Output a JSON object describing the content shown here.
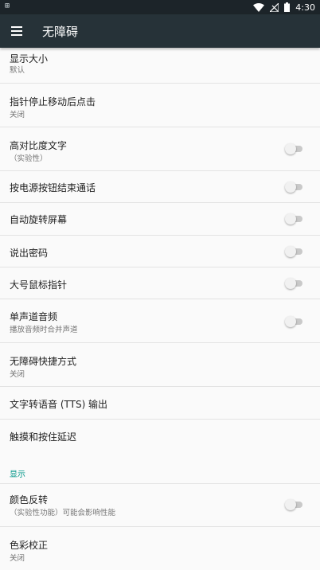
{
  "status_bar": {
    "left_icon": "sim-icon",
    "time": "4:30",
    "icons": [
      "wifi-icon",
      "signal-icon",
      "battery-icon"
    ]
  },
  "app_bar": {
    "menu_icon": "menu-icon",
    "title": "无障碍"
  },
  "list": {
    "display_size": {
      "title": "显示大小",
      "summary": "默认"
    },
    "dwell_click": {
      "title": "指针停止移动后点击",
      "summary": "关闭"
    },
    "high_contrast": {
      "title": "高对比度文字",
      "summary": "（实验性）",
      "enabled": false
    },
    "power_ends_call": {
      "title": "按电源按钮结束通话",
      "enabled": false
    },
    "auto_rotate": {
      "title": "自动旋转屏幕",
      "enabled": false
    },
    "speak_passwords": {
      "title": "说出密码",
      "enabled": false
    },
    "large_pointer": {
      "title": "大号鼠标指针",
      "enabled": false
    },
    "mono_audio": {
      "title": "单声道音频",
      "summary": "播放音频时合并声道",
      "enabled": false
    },
    "shortcut": {
      "title": "无障碍快捷方式",
      "summary": "关闭"
    },
    "tts_output": {
      "title": "文字转语音 (TTS) 输出"
    },
    "touch_hold_delay": {
      "title": "触摸和按住延迟"
    },
    "display_section": {
      "label": "显示"
    },
    "color_inversion": {
      "title": "颜色反转",
      "summary": "（实验性功能）可能会影响性能",
      "enabled": false
    },
    "color_correction": {
      "title": "色彩校正",
      "summary": "关闭"
    }
  },
  "colors": {
    "status_bar": "#1c2429",
    "app_bar": "#263238",
    "accent": "#009688",
    "background": "#fafafa"
  }
}
